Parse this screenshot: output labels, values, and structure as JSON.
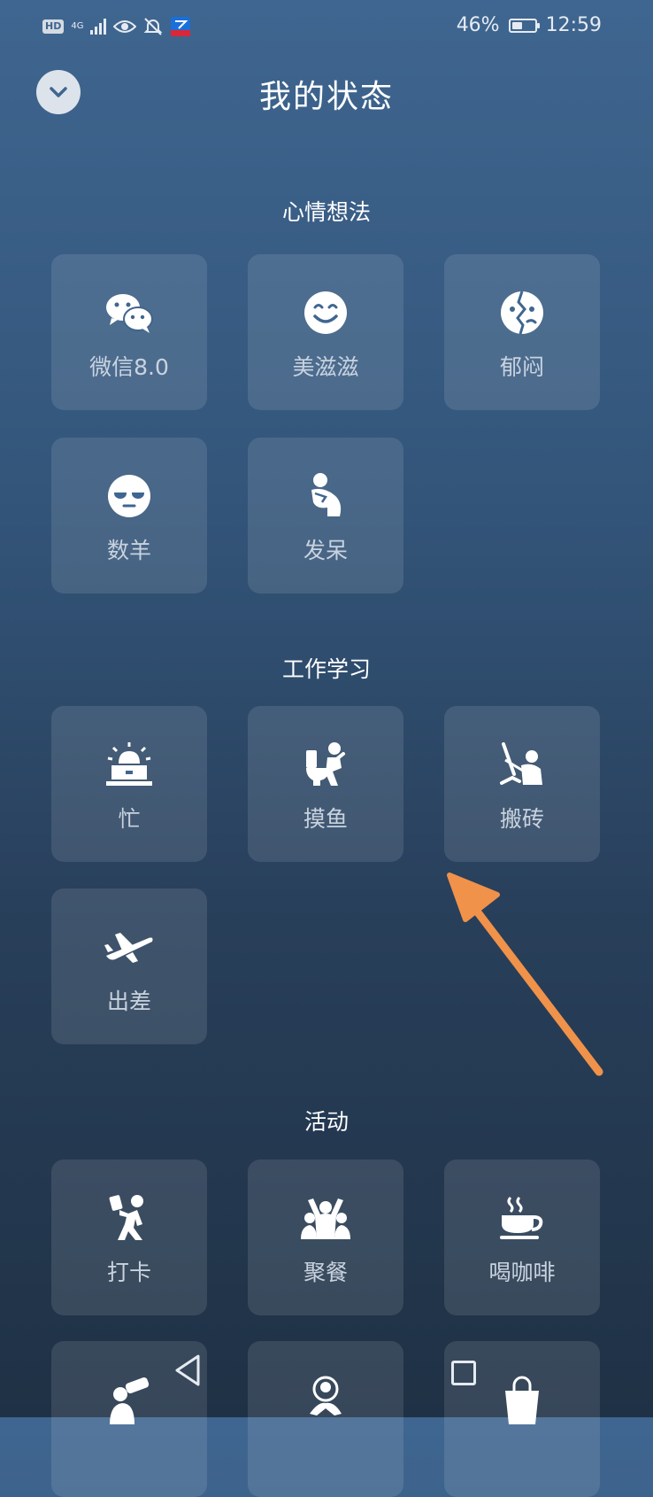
{
  "status": {
    "network": "4G",
    "battery": "46%",
    "battery_level": 0.46,
    "time": "12:59"
  },
  "header": {
    "title": "我的状态"
  },
  "sections": [
    {
      "title": "心情想法",
      "items": [
        {
          "label": "微信8.0",
          "icon": "wechat-icon"
        },
        {
          "label": "美滋滋",
          "icon": "smile-icon"
        },
        {
          "label": "郁闷",
          "icon": "broken-face-icon"
        },
        {
          "label": "数羊",
          "icon": "sleepy-face-icon"
        },
        {
          "label": "发呆",
          "icon": "thinker-icon"
        }
      ]
    },
    {
      "title": "工作学习",
      "items": [
        {
          "label": "忙",
          "icon": "siren-laptop-icon"
        },
        {
          "label": "摸鱼",
          "icon": "toilet-icon"
        },
        {
          "label": "搬砖",
          "icon": "worker-icon"
        },
        {
          "label": "出差",
          "icon": "airplane-icon"
        }
      ]
    },
    {
      "title": "活动",
      "items": [
        {
          "label": "打卡",
          "icon": "checkin-icon"
        },
        {
          "label": "聚餐",
          "icon": "group-icon"
        },
        {
          "label": "喝咖啡",
          "icon": "coffee-icon"
        }
      ]
    }
  ],
  "colors": {
    "accent_arrow": "#f0924a",
    "tile_label": "#c9d3df"
  }
}
